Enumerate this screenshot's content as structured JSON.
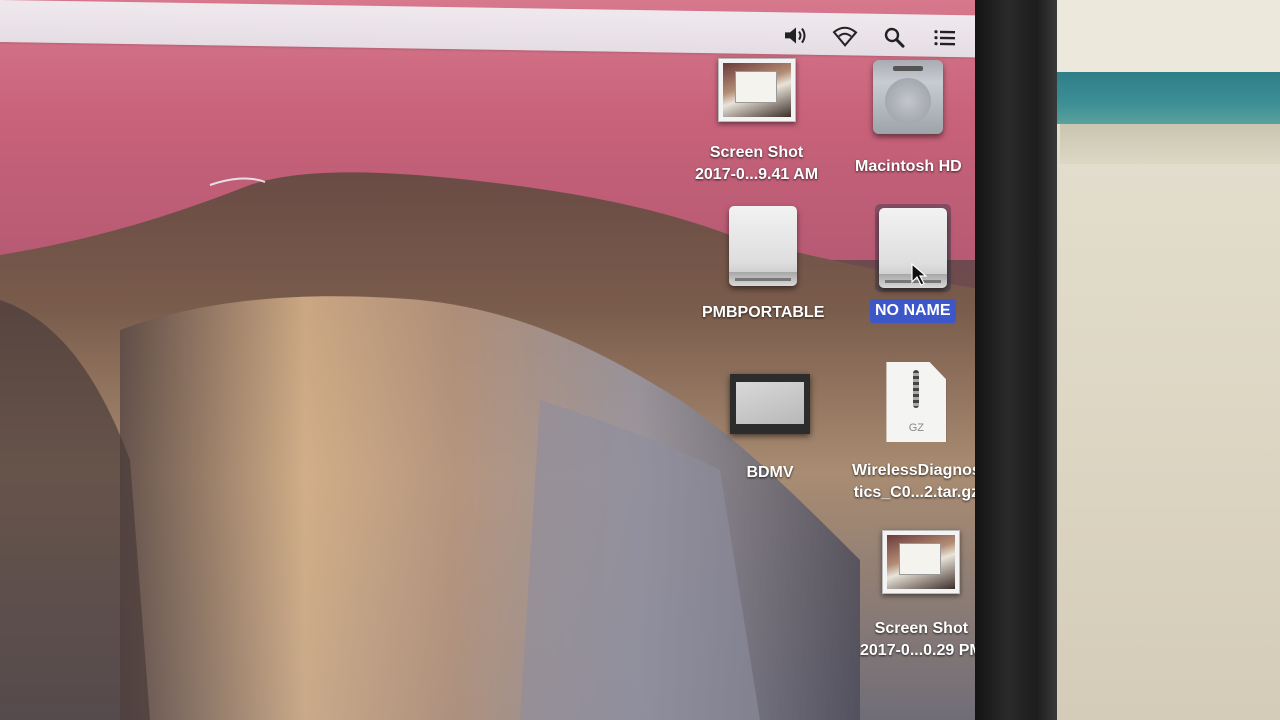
{
  "desktop": {
    "icons": [
      {
        "label": "Screen Shot",
        "label2": "2017-0...9.41 AM",
        "type": "screenshot"
      },
      {
        "label": "Macintosh HD",
        "type": "hard-drive"
      },
      {
        "label": "PMBPORTABLE",
        "type": "external-drive"
      },
      {
        "label": "NO NAME",
        "type": "external-drive",
        "selected": true
      },
      {
        "label": "BDMV",
        "type": "disc-folder"
      },
      {
        "label": "WirelessDiagnos",
        "label2": "tics_C0...2.tar.gz",
        "type": "archive",
        "badge": "GZ"
      },
      {
        "label": "Screen Shot",
        "label2": "2017-0...0.29 PM",
        "type": "screenshot"
      }
    ]
  },
  "menubar": {
    "icons": [
      "volume-icon",
      "wifi-icon",
      "spotlight-search-icon",
      "notification-center-icon"
    ]
  },
  "colors": {
    "selection": "#3d56c8",
    "sky": "#c8627a",
    "menubar": "#ebe4ea",
    "wall_stripe": "#3c8f95"
  }
}
